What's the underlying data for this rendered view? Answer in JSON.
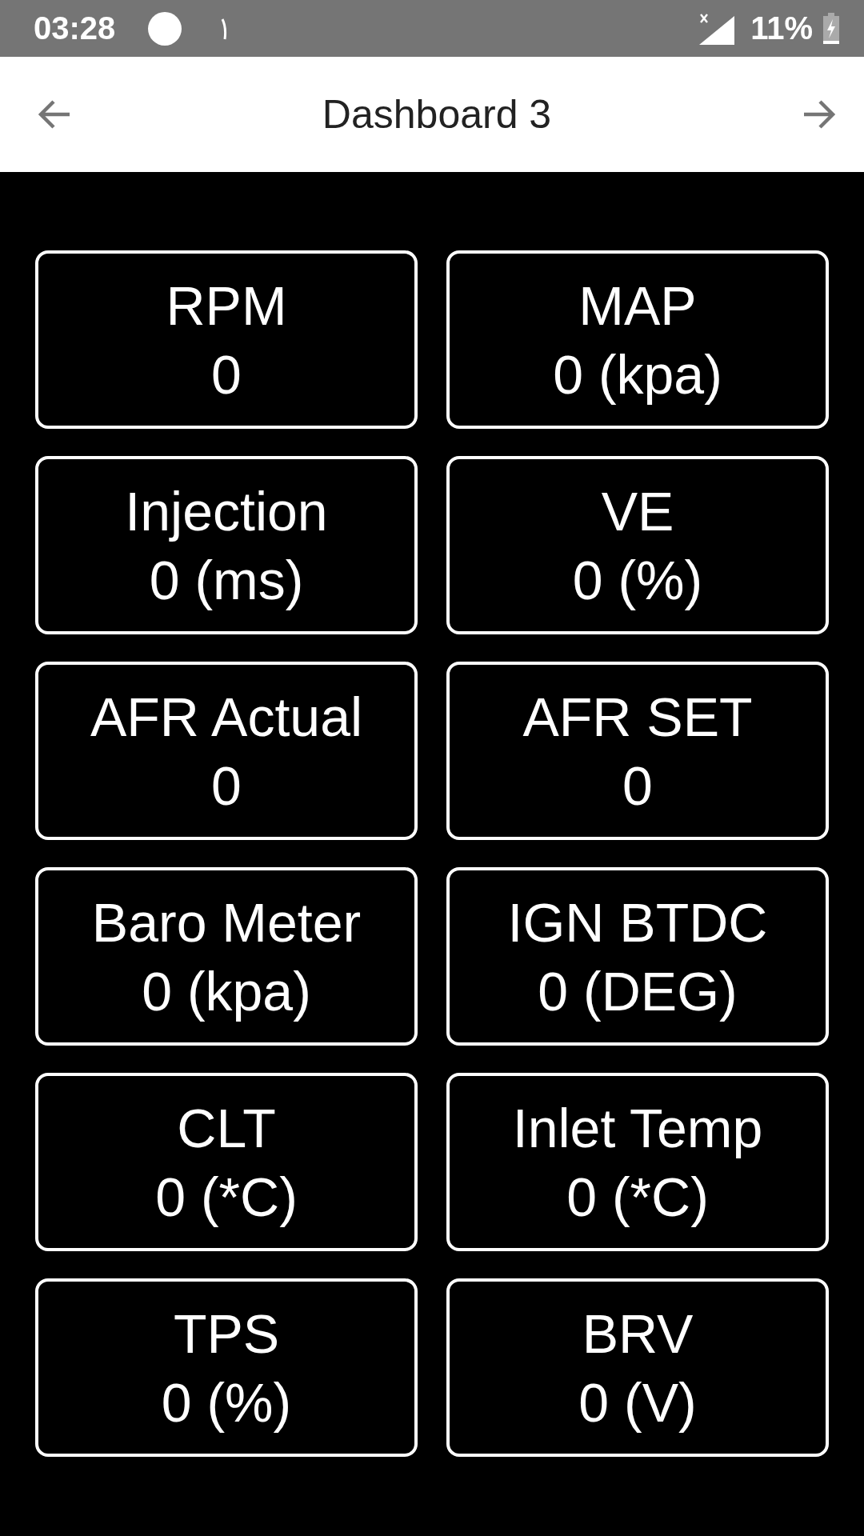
{
  "status_bar": {
    "time": "03:28",
    "battery": "11%"
  },
  "app_bar": {
    "title": "Dashboard 3"
  },
  "gauges": [
    {
      "label": "RPM",
      "value": "0"
    },
    {
      "label": "MAP",
      "value": "0 (kpa)"
    },
    {
      "label": "Injection",
      "value": "0 (ms)"
    },
    {
      "label": "VE",
      "value": "0 (%)"
    },
    {
      "label": "AFR Actual",
      "value": "0"
    },
    {
      "label": "AFR SET",
      "value": "0"
    },
    {
      "label": "Baro Meter",
      "value": "0 (kpa)"
    },
    {
      "label": "IGN BTDC",
      "value": "0 (DEG)"
    },
    {
      "label": "CLT",
      "value": "0 (*C)"
    },
    {
      "label": "Inlet Temp",
      "value": "0 (*C)"
    },
    {
      "label": "TPS",
      "value": "0 (%)"
    },
    {
      "label": "BRV",
      "value": "0 (V)"
    }
  ]
}
